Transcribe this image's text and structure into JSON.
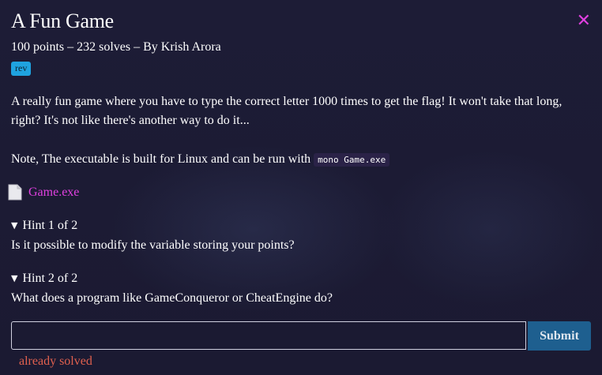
{
  "challenge": {
    "title": "A Fun Game",
    "meta": "100 points – 232 solves – By Krish Arora",
    "tag": "rev",
    "description": "A really fun game where you have to type the correct letter 1000 times to get the flag! It won't take that long, right? It's not like there's another way to do it...",
    "note_prefix": "Note, The executable is built for Linux and can be run with",
    "note_code": "mono Game.exe",
    "file_name": "Game.exe",
    "close_icon": "close-icon",
    "file_icon": "file-icon"
  },
  "hints": [
    {
      "title": "Hint 1 of 2",
      "text": "Is it possible to modify the variable storing your points?"
    },
    {
      "title": "Hint 2 of 2",
      "text": "What does a program like GameConqueror or CheatEngine do?"
    }
  ],
  "form": {
    "input_value": "",
    "submit_label": "Submit",
    "status": "already solved"
  },
  "colors": {
    "background": "#1c1b34",
    "accent": "#e040e0",
    "tag": "#1fa3e0",
    "submit": "#1e5f8f",
    "status": "#e0604e"
  }
}
